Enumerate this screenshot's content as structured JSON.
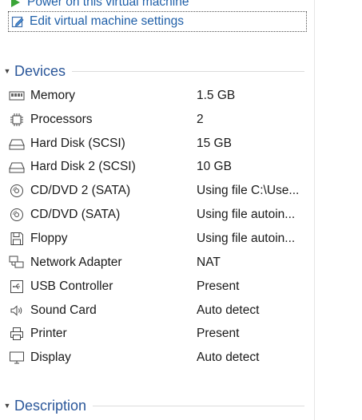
{
  "commands": {
    "power_on": "Power on this virtual machine",
    "edit_settings": "Edit virtual machine settings"
  },
  "devices_section": {
    "title": "Devices"
  },
  "devices": [
    {
      "name": "Memory",
      "value": "1.5 GB",
      "icon": "memory-icon"
    },
    {
      "name": "Processors",
      "value": "2",
      "icon": "processor-icon"
    },
    {
      "name": "Hard Disk (SCSI)",
      "value": "15 GB",
      "icon": "hard-disk-icon"
    },
    {
      "name": "Hard Disk 2 (SCSI)",
      "value": "10 GB",
      "icon": "hard-disk-icon"
    },
    {
      "name": "CD/DVD 2 (SATA)",
      "value": "Using file C:\\Use...",
      "icon": "cd-dvd-icon"
    },
    {
      "name": "CD/DVD (SATA)",
      "value": "Using file autoin...",
      "icon": "cd-dvd-icon"
    },
    {
      "name": "Floppy",
      "value": "Using file autoin...",
      "icon": "floppy-icon"
    },
    {
      "name": "Network Adapter",
      "value": "NAT",
      "icon": "network-adapter-icon"
    },
    {
      "name": "USB Controller",
      "value": "Present",
      "icon": "usb-icon"
    },
    {
      "name": "Sound Card",
      "value": "Auto detect",
      "icon": "sound-card-icon"
    },
    {
      "name": "Printer",
      "value": "Present",
      "icon": "printer-icon"
    },
    {
      "name": "Display",
      "value": "Auto detect",
      "icon": "display-icon"
    }
  ],
  "description_section": {
    "title": "Description"
  },
  "colors": {
    "link": "#1f5fa8",
    "section_title": "#2b579a",
    "power_green": "#3aa537"
  }
}
